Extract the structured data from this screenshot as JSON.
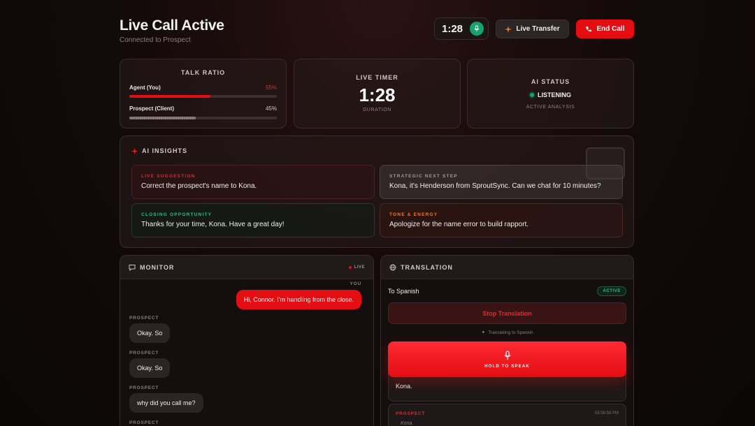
{
  "header": {
    "title": "Live Call Active",
    "subtitle": "Connected to Prospect",
    "timer": "1:28",
    "transfer_label": "Live Transfer",
    "end_label": "End Call"
  },
  "talk_ratio": {
    "title": "TALK RATIO",
    "agent_label": "Agent (You)",
    "agent_pct": "55%",
    "agent_value": 55,
    "prospect_label": "Prospect (Client)",
    "prospect_pct": "45%",
    "prospect_value": 45
  },
  "live_timer": {
    "title": "LIVE TIMER",
    "time": "1:28",
    "caption": "DURATION"
  },
  "ai_status": {
    "title": "AI STATUS",
    "state": "LISTENING",
    "caption": "ACTIVE ANALYSIS"
  },
  "insights": {
    "title": "AI INSIGHTS",
    "items": [
      {
        "label": "LIVE SUGGESTION",
        "text": "Correct the prospect's name to Kona."
      },
      {
        "label": "STRATEGIC NEXT STEP",
        "text": "Kona, it's Henderson from SproutSync. Can we chat for 10 minutes?"
      },
      {
        "label": "CLOSING OPPORTUNITY",
        "text": "Thanks for your time, Kona. Have a great day!"
      },
      {
        "label": "TONE & ENERGY",
        "text": "Apologize for the name error to build rapport."
      }
    ]
  },
  "monitor": {
    "title": "MONITOR",
    "live_badge": "LIVE",
    "messages": [
      {
        "role": "YOU",
        "text": "Hi, Connor. I'm handling from the close."
      },
      {
        "role": "PROSPECT",
        "text": "Okay. So"
      },
      {
        "role": "PROSPECT",
        "text": "Okay. So"
      },
      {
        "role": "PROSPECT",
        "text": "why did you call me?"
      },
      {
        "role": "PROSPECT",
        "text": ""
      }
    ]
  },
  "translation": {
    "title": "TRANSLATION",
    "target": "To Spanish",
    "badge": "ACTIVE",
    "stop_label": "Stop Translation",
    "status": "Translating to Spanish",
    "hold_label": "HOLD TO SPEAK",
    "entry1_text": "Kona.",
    "entry2_role": "PROSPECT",
    "entry2_time": "03:56:58 PM",
    "entry2_text": "Kona."
  },
  "colors": {
    "accent": "#e30d12",
    "green": "#16a36e",
    "orange": "#f27a2a"
  }
}
